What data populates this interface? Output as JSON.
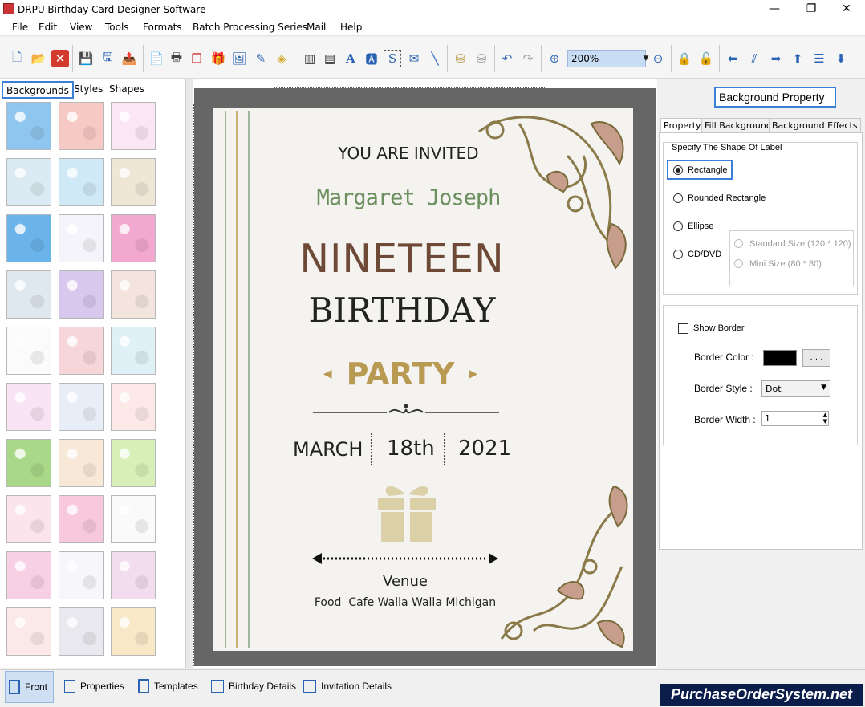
{
  "window": {
    "title": "DRPU Birthday Card Designer Software"
  },
  "menu": [
    "File",
    "Edit",
    "View",
    "Tools",
    "Formats",
    "Batch Processing Series",
    "Mail",
    "Help"
  ],
  "toolbar": {
    "zoom": "200%"
  },
  "left_panel": {
    "tabs": [
      "Backgrounds",
      "Styles",
      "Shapes"
    ]
  },
  "card": {
    "invite": "YOU ARE INVITED",
    "name": "Margaret Joseph",
    "age": "NINETEEN",
    "birthday": "BIRTHDAY",
    "party": "PARTY",
    "month": "MARCH",
    "day": "18th",
    "year": "2021",
    "venue_label": "Venue",
    "venue": "Food  Cafe Walla Walla Michigan"
  },
  "right_panel": {
    "title": "Background Property",
    "tabs": [
      "Property",
      "Fill Background",
      "Background Effects"
    ],
    "shape_group": "Specify The Shape Of Label",
    "shapes": [
      "Rectangle",
      "Rounded Rectangle",
      "Ellipse",
      "CD/DVD"
    ],
    "selected_shape": "Rectangle",
    "cd_sizes": [
      "Standard Size (120 * 120)",
      "Mini Size (80 * 80)"
    ],
    "show_border": "Show Border",
    "border_color_label": "Border Color :",
    "border_color_btn": ". . .",
    "border_style_label": "Border Style :",
    "border_style": "Dot",
    "border_width_label": "Border Width :",
    "border_width": "1"
  },
  "bottom_tabs": [
    "Front",
    "Properties",
    "Templates",
    "Birthday Details",
    "Invitation Details"
  ],
  "brand": "PurchaseOrderSystem.net",
  "colors": {
    "accent": "#3c7fd6",
    "name_green": "#6b8f5e",
    "age_brown": "#6e4a36",
    "party_gold": "#b89a52"
  }
}
